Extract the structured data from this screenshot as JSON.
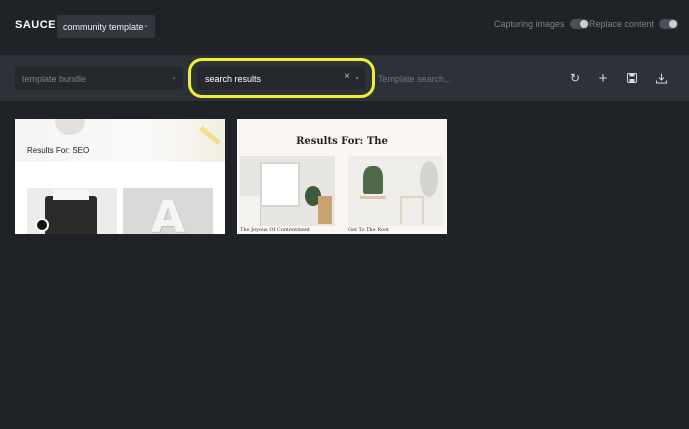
{
  "header": {
    "brand": "SAUCE",
    "template_select": {
      "value": "community template"
    },
    "toggles": [
      {
        "label": "Capturing images",
        "on": false
      },
      {
        "label": "Replace content",
        "on": false
      }
    ]
  },
  "toolbar": {
    "bundle_select": {
      "placeholder": "template bundle"
    },
    "results_select": {
      "value": "search results",
      "clear_glyph": "×"
    },
    "search": {
      "placeholder": "Template search..."
    },
    "actions": [
      {
        "name": "refresh-icon",
        "glyph": "↻"
      },
      {
        "name": "plus-icon",
        "glyph": "+"
      },
      {
        "name": "save-icon",
        "glyph": "▪"
      },
      {
        "name": "download-icon",
        "glyph": "⭳"
      }
    ],
    "highlight_color": "#f2ee31"
  },
  "templates": [
    {
      "title": "Results For: SEO"
    },
    {
      "title": "Results For: The",
      "captions": [
        "The Joyous Of Contentment",
        "Get To The Root"
      ]
    }
  ]
}
